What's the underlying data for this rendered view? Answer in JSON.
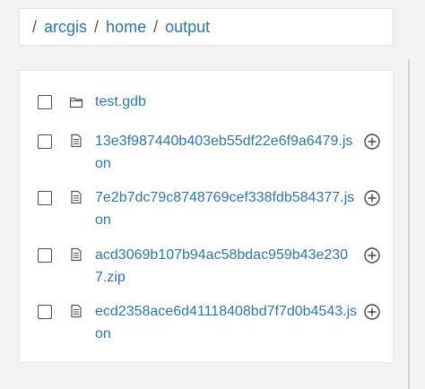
{
  "breadcrumb": {
    "separator": "/",
    "items": [
      "arcgis",
      "home",
      "output"
    ]
  },
  "files": [
    {
      "name": "test.gdb",
      "type": "folder",
      "icon": "folder-icon",
      "has_add": false
    },
    {
      "name": "13e3f987440b403eb55df22e6f9a6479.json",
      "type": "file",
      "icon": "file-icon",
      "has_add": true
    },
    {
      "name": "7e2b7dc79c8748769cef338fdb584377.json",
      "type": "file",
      "icon": "file-icon",
      "has_add": true
    },
    {
      "name": "acd3069b107b94ac58bdac959b43e2307.zip",
      "type": "file",
      "icon": "file-icon",
      "has_add": true
    },
    {
      "name": "ecd2358ace6d41118408bd7f7d0b4543.json",
      "type": "file",
      "icon": "file-icon",
      "has_add": true
    }
  ],
  "colors": {
    "link": "#2b77b3",
    "icon": "#555555"
  }
}
